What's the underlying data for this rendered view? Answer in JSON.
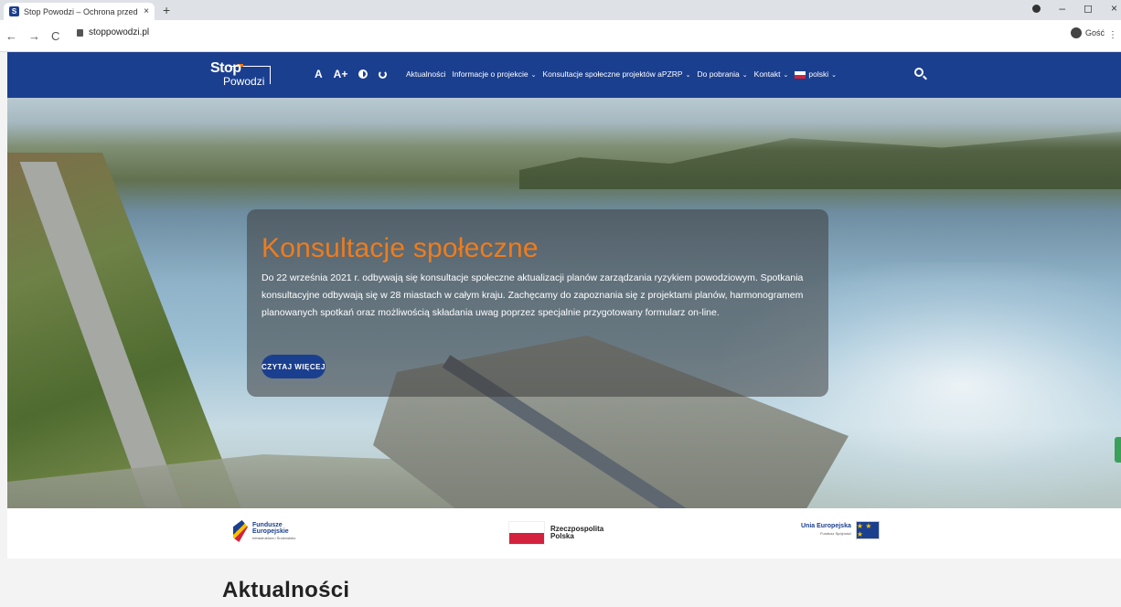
{
  "browser": {
    "tab_title": "Stop Powodzi – Ochrona przed p",
    "tab_close": "×",
    "new_tab": "+",
    "url": "stoppowodzi.pl",
    "profile_label": "Gość",
    "back": "←",
    "forward": "→",
    "reload": "C",
    "minimize": "–",
    "restore": "◻",
    "close": "×",
    "menu": "⋮"
  },
  "header": {
    "logo_line1": "Stop",
    "logo_line2": "Powodzi",
    "font_normal": "A",
    "font_larger": "A+",
    "nav": [
      {
        "label": "Aktualności",
        "has_dropdown": false
      },
      {
        "label": "Informacje o projekcie",
        "has_dropdown": true
      },
      {
        "label": "Konsultacje społeczne projektów aPZRP",
        "has_dropdown": true
      },
      {
        "label": "Do pobrania",
        "has_dropdown": true
      },
      {
        "label": "Kontakt",
        "has_dropdown": true
      },
      {
        "label": "polski",
        "has_dropdown": true
      }
    ],
    "chevron": "⌄"
  },
  "hero": {
    "title": "Konsultacje społeczne",
    "text": "Do 22 września 2021 r. odbywają się konsultacje społeczne aktualizacji planów zarządzania ryzykiem powodziowym. Spotkania konsultacyjne odbywają się w 28 miastach w całym kraju. Zachęcamy do zapoznania się z projektami planów, harmonogramem planowanych spotkań oraz możliwością składania uwag poprzez specjalnie przygotowany formularz on-line.",
    "button": "CZYTAJ WIĘCEJ"
  },
  "partners": {
    "fe_line1": "Fundusze",
    "fe_line2": "Europejskie",
    "fe_sub": "Infrastruktura i Środowisko",
    "pl_line1": "Rzeczpospolita",
    "pl_line2": "Polska",
    "eu_line1": "Unia Europejska",
    "eu_sub": "Fundusz Spójności",
    "eu_stars": "★ ★ ★"
  },
  "section": {
    "news_title": "Aktualności"
  },
  "colors": {
    "brand_blue": "#1b3f8f",
    "accent_orange": "#f07c1b"
  }
}
